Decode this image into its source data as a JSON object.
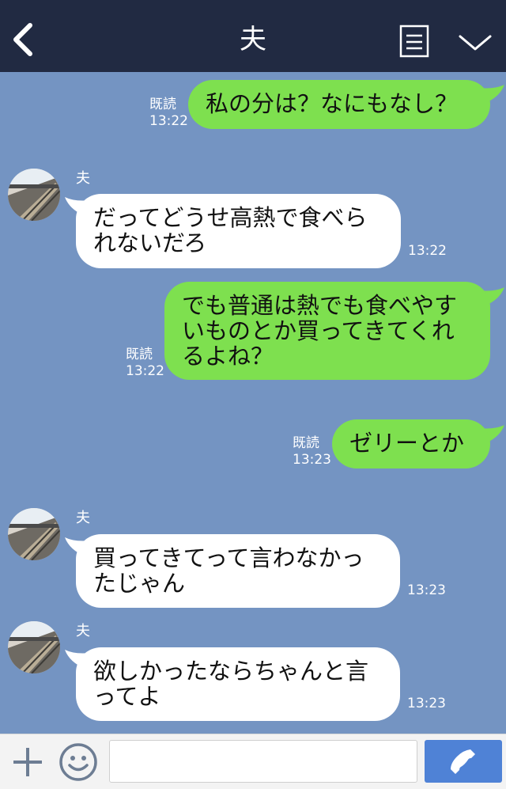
{
  "header": {
    "title": "夫",
    "colors": {
      "background": "#212a42",
      "text": "#ffffff"
    },
    "icons": {
      "back": "chevron-left-icon",
      "menu": "note-list-icon",
      "collapse": "chevron-down-icon"
    }
  },
  "chat": {
    "background": "#7494c2",
    "sender_name": "夫",
    "read_label": "既読",
    "messages": [
      {
        "side": "right",
        "text": "私の分は？なにもなし？",
        "read": "既読",
        "time": "13:22"
      },
      {
        "side": "left",
        "sender": "夫",
        "text": "だってどうせ高熱で食べら\nれないだろ",
        "time": "13:22"
      },
      {
        "side": "right",
        "text": "でも普通は熱でも食べやす\nいものとか買ってきてくれ\nるよね？",
        "read": "既読",
        "time": "13:22"
      },
      {
        "side": "right",
        "text": "ゼリーとか",
        "read": "既読",
        "time": "13:23"
      },
      {
        "side": "left",
        "sender": "夫",
        "text": "買ってきてって言わなかっ\nたじゃん",
        "time": "13:23"
      },
      {
        "side": "left",
        "sender": "夫",
        "text": "欲しかったならちゃんと言\nってよ",
        "time": "13:23"
      }
    ],
    "colors": {
      "right_bubble": "#7ee04f",
      "left_bubble": "#ffffff"
    }
  },
  "bottom_bar": {
    "input_value": "",
    "icons": {
      "plus": "plus-icon",
      "emoji": "smiley-icon",
      "call": "phone-icon"
    },
    "colors": {
      "call_button": "#4f82d6"
    }
  }
}
